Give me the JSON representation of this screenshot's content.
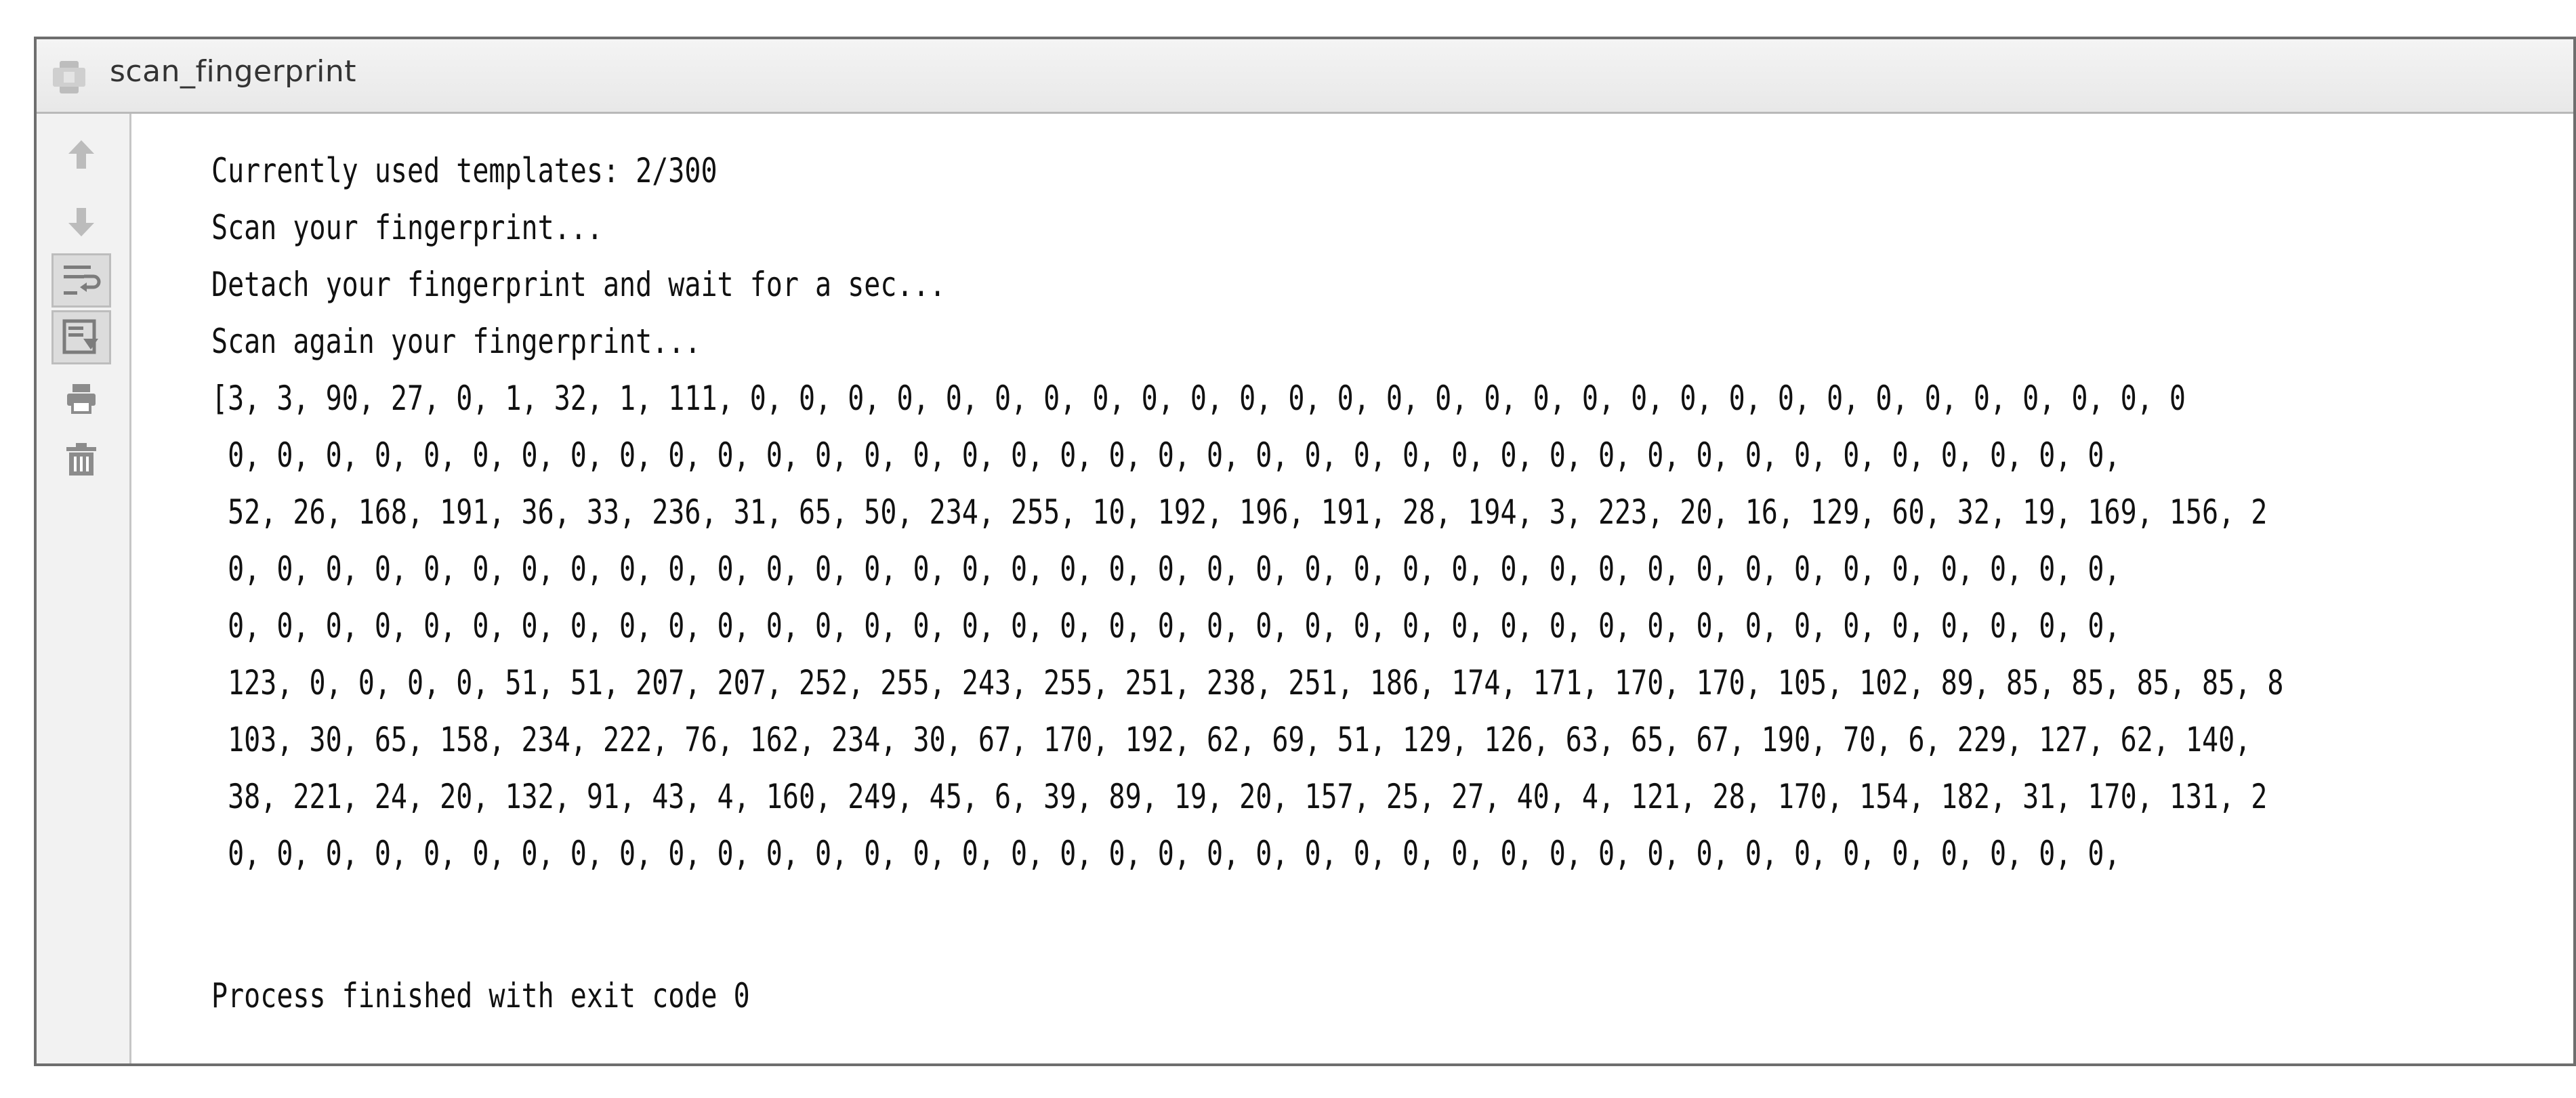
{
  "window": {
    "title": "scan_fingerprint"
  },
  "toolbar": {
    "items": [
      {
        "icon": "arrow-up-icon",
        "label": "Up to previous occurrence"
      },
      {
        "icon": "arrow-down-icon",
        "label": "Down to next occurrence"
      },
      {
        "icon": "soft-wrap-icon",
        "toggled": true
      },
      {
        "icon": "scroll-to-end-icon",
        "toggled": true
      },
      {
        "icon": "print-icon"
      },
      {
        "icon": "trash-icon"
      }
    ]
  },
  "console": {
    "lines": [
      "Currently used templates: 2/300",
      "Scan your fingerprint...",
      "Detach your fingerprint and wait for a sec...",
      "Scan again your fingerprint...",
      "[3, 3, 90, 27, 0, 1, 32, 1, 111, 0, 0, 0, 0, 0, 0, 0, 0, 0, 0, 0, 0, 0, 0, 0, 0, 0, 0, 0, 0, 0, 0, 0, 0, 0, 0, 0, 0, 0, 0",
      " 0, 0, 0, 0, 0, 0, 0, 0, 0, 0, 0, 0, 0, 0, 0, 0, 0, 0, 0, 0, 0, 0, 0, 0, 0, 0, 0, 0, 0, 0, 0, 0, 0, 0, 0, 0, 0, 0, 0,",
      " 52, 26, 168, 191, 36, 33, 236, 31, 65, 50, 234, 255, 10, 192, 196, 191, 28, 194, 3, 223, 20, 16, 129, 60, 32, 19, 169, 156, 2",
      " 0, 0, 0, 0, 0, 0, 0, 0, 0, 0, 0, 0, 0, 0, 0, 0, 0, 0, 0, 0, 0, 0, 0, 0, 0, 0, 0, 0, 0, 0, 0, 0, 0, 0, 0, 0, 0, 0, 0,",
      " 0, 0, 0, 0, 0, 0, 0, 0, 0, 0, 0, 0, 0, 0, 0, 0, 0, 0, 0, 0, 0, 0, 0, 0, 0, 0, 0, 0, 0, 0, 0, 0, 0, 0, 0, 0, 0, 0, 0,",
      " 123, 0, 0, 0, 0, 51, 51, 207, 207, 252, 255, 243, 255, 251, 238, 251, 186, 174, 171, 170, 170, 105, 102, 89, 85, 85, 85, 85, 8",
      " 103, 30, 65, 158, 234, 222, 76, 162, 234, 30, 67, 170, 192, 62, 69, 51, 129, 126, 63, 65, 67, 190, 70, 6, 229, 127, 62, 140,",
      " 38, 221, 24, 20, 132, 91, 43, 4, 160, 249, 45, 6, 39, 89, 19, 20, 157, 25, 27, 40, 4, 121, 28, 170, 154, 182, 31, 170, 131, 2",
      " 0, 0, 0, 0, 0, 0, 0, 0, 0, 0, 0, 0, 0, 0, 0, 0, 0, 0, 0, 0, 0, 0, 0, 0, 0, 0, 0, 0, 0, 0, 0, 0, 0, 0, 0, 0, 0, 0, 0,",
      "",
      "Process finished with exit code 0"
    ]
  },
  "colors": {
    "window_border": "#6e6e6e",
    "titlebar_bg": "#ececec",
    "toolbar_bg": "#f2f2f2",
    "icon_gray": "#8c8c8c",
    "text": "#111111"
  }
}
